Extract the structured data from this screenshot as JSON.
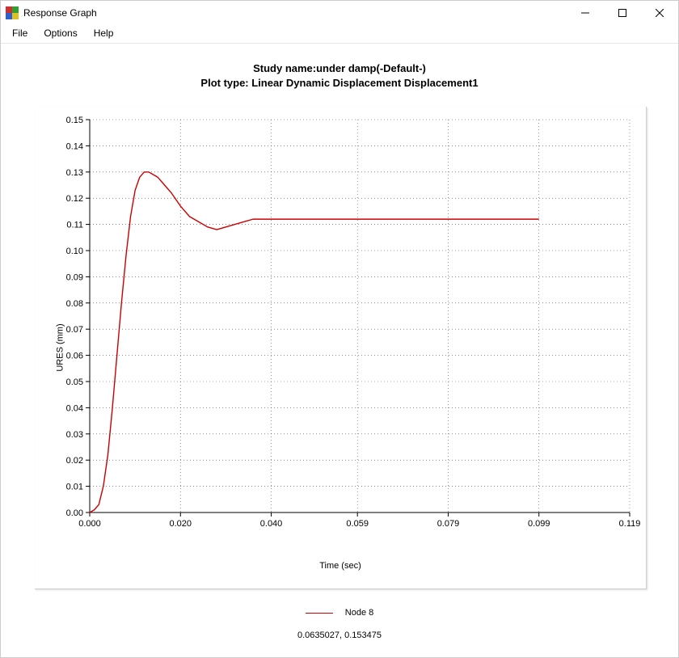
{
  "window": {
    "title": "Response Graph"
  },
  "menubar": {
    "items": [
      "File",
      "Options",
      "Help"
    ]
  },
  "chart": {
    "title_line1": "Study name:under damp(-Default-)",
    "title_line2": "Plot type: Linear Dynamic Displacement Displacement1",
    "xlabel": "Time (sec)",
    "ylabel": "URES (mm)"
  },
  "legend": {
    "series_name": "Node 8",
    "series_color": "#cc0000"
  },
  "coord_readout": "0.0635027, 0.153475",
  "chart_data": {
    "type": "line",
    "title": "Study name:under damp(-Default-)  Plot type: Linear Dynamic Displacement Displacement1",
    "xlabel": "Time (sec)",
    "ylabel": "URES (mm)",
    "xlim": [
      0.0,
      0.119
    ],
    "ylim": [
      0.0,
      0.15
    ],
    "x_ticks": [
      0.0,
      0.02,
      0.04,
      0.059,
      0.079,
      0.099,
      0.119
    ],
    "x_tick_labels": [
      "0.000",
      "0.020",
      "0.040",
      "0.059",
      "0.079",
      "0.099",
      "0.119"
    ],
    "y_ticks": [
      0.0,
      0.01,
      0.02,
      0.03,
      0.04,
      0.05,
      0.06,
      0.07,
      0.08,
      0.09,
      0.1,
      0.11,
      0.12,
      0.13,
      0.14,
      0.15
    ],
    "y_tick_labels": [
      "0.00",
      "0.01",
      "0.02",
      "0.03",
      "0.04",
      "0.05",
      "0.06",
      "0.07",
      "0.08",
      "0.09",
      "0.10",
      "0.11",
      "0.12",
      "0.13",
      "0.14",
      "0.15"
    ],
    "series": [
      {
        "name": "Node 8",
        "color": "#cc0000",
        "x": [
          0.0,
          0.001,
          0.002,
          0.003,
          0.004,
          0.005,
          0.006,
          0.007,
          0.008,
          0.009,
          0.01,
          0.011,
          0.012,
          0.013,
          0.014,
          0.015,
          0.016,
          0.017,
          0.018,
          0.02,
          0.022,
          0.024,
          0.026,
          0.028,
          0.03,
          0.032,
          0.034,
          0.036,
          0.038,
          0.04,
          0.045,
          0.05,
          0.06,
          0.07,
          0.08,
          0.09,
          0.099
        ],
        "y": [
          0.0,
          0.001,
          0.003,
          0.01,
          0.022,
          0.04,
          0.06,
          0.08,
          0.098,
          0.113,
          0.123,
          0.128,
          0.13,
          0.13,
          0.129,
          0.128,
          0.126,
          0.124,
          0.122,
          0.117,
          0.113,
          0.111,
          0.109,
          0.108,
          0.109,
          0.11,
          0.111,
          0.112,
          0.112,
          0.112,
          0.112,
          0.112,
          0.112,
          0.112,
          0.112,
          0.112,
          0.112
        ]
      }
    ]
  }
}
